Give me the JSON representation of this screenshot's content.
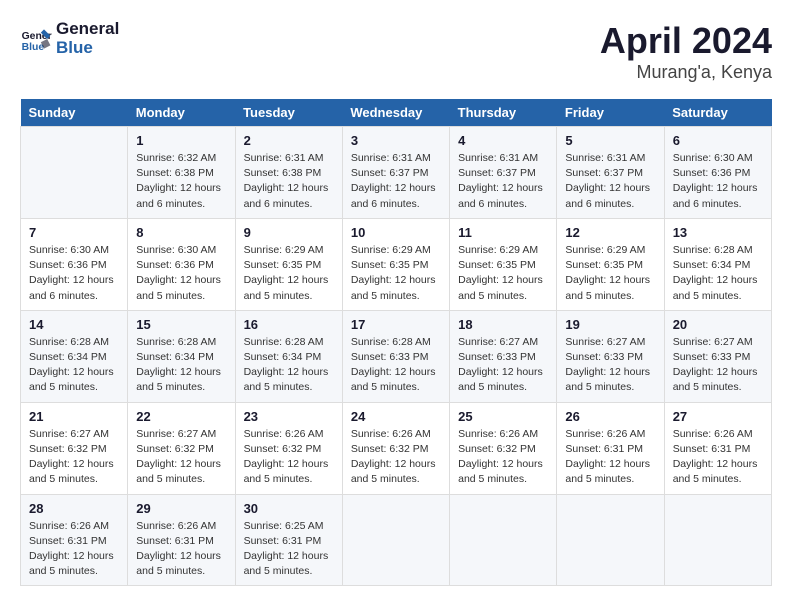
{
  "header": {
    "logo_line1": "General",
    "logo_line2": "Blue",
    "title": "April 2024",
    "subtitle": "Murang'a, Kenya"
  },
  "columns": [
    "Sunday",
    "Monday",
    "Tuesday",
    "Wednesday",
    "Thursday",
    "Friday",
    "Saturday"
  ],
  "weeks": [
    [
      {
        "day": "",
        "info": ""
      },
      {
        "day": "1",
        "info": "Sunrise: 6:32 AM\nSunset: 6:38 PM\nDaylight: 12 hours\nand 6 minutes."
      },
      {
        "day": "2",
        "info": "Sunrise: 6:31 AM\nSunset: 6:38 PM\nDaylight: 12 hours\nand 6 minutes."
      },
      {
        "day": "3",
        "info": "Sunrise: 6:31 AM\nSunset: 6:37 PM\nDaylight: 12 hours\nand 6 minutes."
      },
      {
        "day": "4",
        "info": "Sunrise: 6:31 AM\nSunset: 6:37 PM\nDaylight: 12 hours\nand 6 minutes."
      },
      {
        "day": "5",
        "info": "Sunrise: 6:31 AM\nSunset: 6:37 PM\nDaylight: 12 hours\nand 6 minutes."
      },
      {
        "day": "6",
        "info": "Sunrise: 6:30 AM\nSunset: 6:36 PM\nDaylight: 12 hours\nand 6 minutes."
      }
    ],
    [
      {
        "day": "7",
        "info": "Sunrise: 6:30 AM\nSunset: 6:36 PM\nDaylight: 12 hours\nand 6 minutes."
      },
      {
        "day": "8",
        "info": "Sunrise: 6:30 AM\nSunset: 6:36 PM\nDaylight: 12 hours\nand 5 minutes."
      },
      {
        "day": "9",
        "info": "Sunrise: 6:29 AM\nSunset: 6:35 PM\nDaylight: 12 hours\nand 5 minutes."
      },
      {
        "day": "10",
        "info": "Sunrise: 6:29 AM\nSunset: 6:35 PM\nDaylight: 12 hours\nand 5 minutes."
      },
      {
        "day": "11",
        "info": "Sunrise: 6:29 AM\nSunset: 6:35 PM\nDaylight: 12 hours\nand 5 minutes."
      },
      {
        "day": "12",
        "info": "Sunrise: 6:29 AM\nSunset: 6:35 PM\nDaylight: 12 hours\nand 5 minutes."
      },
      {
        "day": "13",
        "info": "Sunrise: 6:28 AM\nSunset: 6:34 PM\nDaylight: 12 hours\nand 5 minutes."
      }
    ],
    [
      {
        "day": "14",
        "info": "Sunrise: 6:28 AM\nSunset: 6:34 PM\nDaylight: 12 hours\nand 5 minutes."
      },
      {
        "day": "15",
        "info": "Sunrise: 6:28 AM\nSunset: 6:34 PM\nDaylight: 12 hours\nand 5 minutes."
      },
      {
        "day": "16",
        "info": "Sunrise: 6:28 AM\nSunset: 6:34 PM\nDaylight: 12 hours\nand 5 minutes."
      },
      {
        "day": "17",
        "info": "Sunrise: 6:28 AM\nSunset: 6:33 PM\nDaylight: 12 hours\nand 5 minutes."
      },
      {
        "day": "18",
        "info": "Sunrise: 6:27 AM\nSunset: 6:33 PM\nDaylight: 12 hours\nand 5 minutes."
      },
      {
        "day": "19",
        "info": "Sunrise: 6:27 AM\nSunset: 6:33 PM\nDaylight: 12 hours\nand 5 minutes."
      },
      {
        "day": "20",
        "info": "Sunrise: 6:27 AM\nSunset: 6:33 PM\nDaylight: 12 hours\nand 5 minutes."
      }
    ],
    [
      {
        "day": "21",
        "info": "Sunrise: 6:27 AM\nSunset: 6:32 PM\nDaylight: 12 hours\nand 5 minutes."
      },
      {
        "day": "22",
        "info": "Sunrise: 6:27 AM\nSunset: 6:32 PM\nDaylight: 12 hours\nand 5 minutes."
      },
      {
        "day": "23",
        "info": "Sunrise: 6:26 AM\nSunset: 6:32 PM\nDaylight: 12 hours\nand 5 minutes."
      },
      {
        "day": "24",
        "info": "Sunrise: 6:26 AM\nSunset: 6:32 PM\nDaylight: 12 hours\nand 5 minutes."
      },
      {
        "day": "25",
        "info": "Sunrise: 6:26 AM\nSunset: 6:32 PM\nDaylight: 12 hours\nand 5 minutes."
      },
      {
        "day": "26",
        "info": "Sunrise: 6:26 AM\nSunset: 6:31 PM\nDaylight: 12 hours\nand 5 minutes."
      },
      {
        "day": "27",
        "info": "Sunrise: 6:26 AM\nSunset: 6:31 PM\nDaylight: 12 hours\nand 5 minutes."
      }
    ],
    [
      {
        "day": "28",
        "info": "Sunrise: 6:26 AM\nSunset: 6:31 PM\nDaylight: 12 hours\nand 5 minutes."
      },
      {
        "day": "29",
        "info": "Sunrise: 6:26 AM\nSunset: 6:31 PM\nDaylight: 12 hours\nand 5 minutes."
      },
      {
        "day": "30",
        "info": "Sunrise: 6:25 AM\nSunset: 6:31 PM\nDaylight: 12 hours\nand 5 minutes."
      },
      {
        "day": "",
        "info": ""
      },
      {
        "day": "",
        "info": ""
      },
      {
        "day": "",
        "info": ""
      },
      {
        "day": "",
        "info": ""
      }
    ]
  ]
}
